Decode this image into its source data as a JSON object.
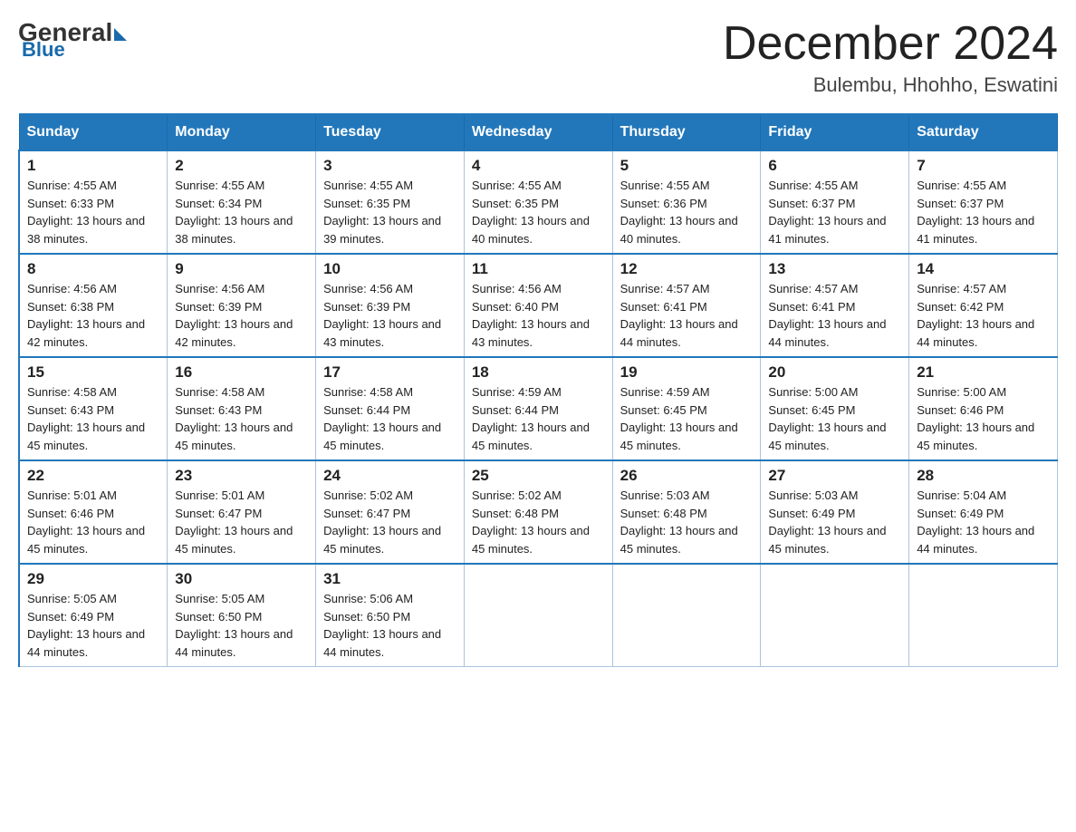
{
  "header": {
    "logo_general": "General",
    "logo_blue": "Blue",
    "month_title": "December 2024",
    "location": "Bulembu, Hhohho, Eswatini"
  },
  "days_of_week": [
    "Sunday",
    "Monday",
    "Tuesday",
    "Wednesday",
    "Thursday",
    "Friday",
    "Saturday"
  ],
  "weeks": [
    [
      {
        "day": "1",
        "sunrise": "4:55 AM",
        "sunset": "6:33 PM",
        "daylight": "13 hours and 38 minutes."
      },
      {
        "day": "2",
        "sunrise": "4:55 AM",
        "sunset": "6:34 PM",
        "daylight": "13 hours and 38 minutes."
      },
      {
        "day": "3",
        "sunrise": "4:55 AM",
        "sunset": "6:35 PM",
        "daylight": "13 hours and 39 minutes."
      },
      {
        "day": "4",
        "sunrise": "4:55 AM",
        "sunset": "6:35 PM",
        "daylight": "13 hours and 40 minutes."
      },
      {
        "day": "5",
        "sunrise": "4:55 AM",
        "sunset": "6:36 PM",
        "daylight": "13 hours and 40 minutes."
      },
      {
        "day": "6",
        "sunrise": "4:55 AM",
        "sunset": "6:37 PM",
        "daylight": "13 hours and 41 minutes."
      },
      {
        "day": "7",
        "sunrise": "4:55 AM",
        "sunset": "6:37 PM",
        "daylight": "13 hours and 41 minutes."
      }
    ],
    [
      {
        "day": "8",
        "sunrise": "4:56 AM",
        "sunset": "6:38 PM",
        "daylight": "13 hours and 42 minutes."
      },
      {
        "day": "9",
        "sunrise": "4:56 AM",
        "sunset": "6:39 PM",
        "daylight": "13 hours and 42 minutes."
      },
      {
        "day": "10",
        "sunrise": "4:56 AM",
        "sunset": "6:39 PM",
        "daylight": "13 hours and 43 minutes."
      },
      {
        "day": "11",
        "sunrise": "4:56 AM",
        "sunset": "6:40 PM",
        "daylight": "13 hours and 43 minutes."
      },
      {
        "day": "12",
        "sunrise": "4:57 AM",
        "sunset": "6:41 PM",
        "daylight": "13 hours and 44 minutes."
      },
      {
        "day": "13",
        "sunrise": "4:57 AM",
        "sunset": "6:41 PM",
        "daylight": "13 hours and 44 minutes."
      },
      {
        "day": "14",
        "sunrise": "4:57 AM",
        "sunset": "6:42 PM",
        "daylight": "13 hours and 44 minutes."
      }
    ],
    [
      {
        "day": "15",
        "sunrise": "4:58 AM",
        "sunset": "6:43 PM",
        "daylight": "13 hours and 45 minutes."
      },
      {
        "day": "16",
        "sunrise": "4:58 AM",
        "sunset": "6:43 PM",
        "daylight": "13 hours and 45 minutes."
      },
      {
        "day": "17",
        "sunrise": "4:58 AM",
        "sunset": "6:44 PM",
        "daylight": "13 hours and 45 minutes."
      },
      {
        "day": "18",
        "sunrise": "4:59 AM",
        "sunset": "6:44 PM",
        "daylight": "13 hours and 45 minutes."
      },
      {
        "day": "19",
        "sunrise": "4:59 AM",
        "sunset": "6:45 PM",
        "daylight": "13 hours and 45 minutes."
      },
      {
        "day": "20",
        "sunrise": "5:00 AM",
        "sunset": "6:45 PM",
        "daylight": "13 hours and 45 minutes."
      },
      {
        "day": "21",
        "sunrise": "5:00 AM",
        "sunset": "6:46 PM",
        "daylight": "13 hours and 45 minutes."
      }
    ],
    [
      {
        "day": "22",
        "sunrise": "5:01 AM",
        "sunset": "6:46 PM",
        "daylight": "13 hours and 45 minutes."
      },
      {
        "day": "23",
        "sunrise": "5:01 AM",
        "sunset": "6:47 PM",
        "daylight": "13 hours and 45 minutes."
      },
      {
        "day": "24",
        "sunrise": "5:02 AM",
        "sunset": "6:47 PM",
        "daylight": "13 hours and 45 minutes."
      },
      {
        "day": "25",
        "sunrise": "5:02 AM",
        "sunset": "6:48 PM",
        "daylight": "13 hours and 45 minutes."
      },
      {
        "day": "26",
        "sunrise": "5:03 AM",
        "sunset": "6:48 PM",
        "daylight": "13 hours and 45 minutes."
      },
      {
        "day": "27",
        "sunrise": "5:03 AM",
        "sunset": "6:49 PM",
        "daylight": "13 hours and 45 minutes."
      },
      {
        "day": "28",
        "sunrise": "5:04 AM",
        "sunset": "6:49 PM",
        "daylight": "13 hours and 44 minutes."
      }
    ],
    [
      {
        "day": "29",
        "sunrise": "5:05 AM",
        "sunset": "6:49 PM",
        "daylight": "13 hours and 44 minutes."
      },
      {
        "day": "30",
        "sunrise": "5:05 AM",
        "sunset": "6:50 PM",
        "daylight": "13 hours and 44 minutes."
      },
      {
        "day": "31",
        "sunrise": "5:06 AM",
        "sunset": "6:50 PM",
        "daylight": "13 hours and 44 minutes."
      },
      null,
      null,
      null,
      null
    ]
  ],
  "labels": {
    "sunrise_prefix": "Sunrise: ",
    "sunset_prefix": "Sunset: ",
    "daylight_prefix": "Daylight: "
  }
}
